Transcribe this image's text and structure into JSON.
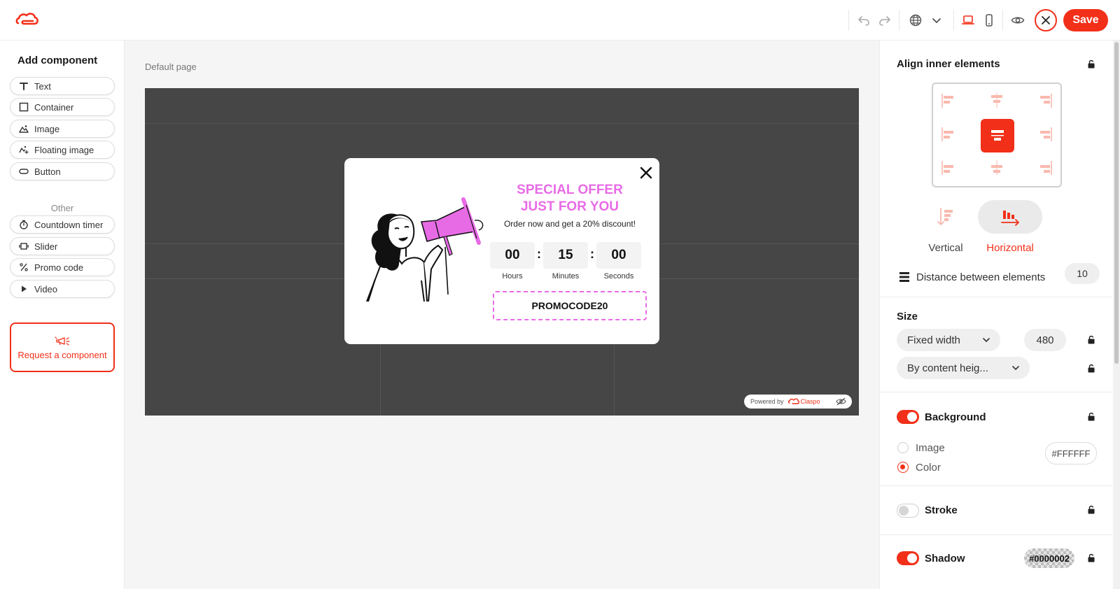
{
  "colors": {
    "accent": "#f22f18",
    "popup_pink": "#e86be6",
    "canvas_bg": "#464646"
  },
  "toolbar": {
    "icons": [
      "undo-icon",
      "redo-icon",
      "globe-icon",
      "chevron-down-icon",
      "desktop-icon",
      "mobile-icon",
      "eye-icon",
      "close-icon"
    ],
    "save_label": "Save"
  },
  "sidebar": {
    "title": "Add component",
    "components": [
      {
        "label": "Text",
        "icon": "text-icon"
      },
      {
        "label": "Container",
        "icon": "container-icon"
      },
      {
        "label": "Image",
        "icon": "image-icon"
      },
      {
        "label": "Floating image",
        "icon": "floating-image-icon"
      },
      {
        "label": "Button",
        "icon": "button-icon"
      }
    ],
    "other_label": "Other",
    "other": [
      {
        "label": "Countdown timer",
        "icon": "timer-icon"
      },
      {
        "label": "Slider",
        "icon": "slider-icon"
      },
      {
        "label": "Promo code",
        "icon": "percent-icon"
      },
      {
        "label": "Video",
        "icon": "play-icon"
      }
    ],
    "request_label": "Request a component"
  },
  "canvas": {
    "page_label": "Default page",
    "powered_by": "Powered by",
    "brand": "Claspo",
    "popup": {
      "title_line1": "SPECIAL OFFER",
      "title_line2": "JUST FOR YOU",
      "subtitle": "Order now and get a 20% discount!",
      "timer": [
        {
          "value": "00",
          "label": "Hours"
        },
        {
          "value": "15",
          "label": "Minutes"
        },
        {
          "value": "00",
          "label": "Seconds"
        }
      ],
      "separator": ":",
      "promo_code": "PROMOCODE20"
    }
  },
  "panel": {
    "align_title": "Align inner elements",
    "direction_options": [
      {
        "label": "Vertical",
        "selected": false
      },
      {
        "label": "Horizontal",
        "selected": true
      }
    ],
    "distance_label": "Distance between elements",
    "distance_value": "10",
    "size_title": "Size",
    "width_mode": "Fixed width",
    "width_value": "480",
    "height_mode": "By content heig...",
    "background_title": "Background",
    "background_enabled": true,
    "background_options": [
      {
        "label": "Image",
        "selected": false
      },
      {
        "label": "Color",
        "selected": true
      }
    ],
    "background_color": "#FFFFFF",
    "stroke_title": "Stroke",
    "stroke_enabled": false,
    "shadow_title": "Shadow",
    "shadow_enabled": true,
    "shadow_color": "#0000002"
  }
}
